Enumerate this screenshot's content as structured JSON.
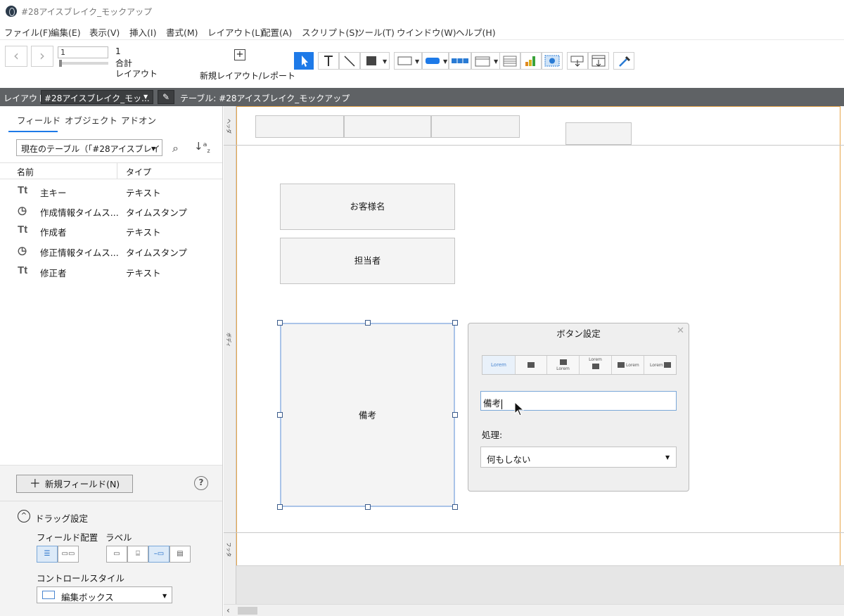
{
  "window": {
    "title": "#28アイスブレイク_モックアップ"
  },
  "menu": [
    "ファイル(F)",
    "編集(E)",
    "表示(V)",
    "挿入(I)",
    "書式(M)",
    "レイアウト(L)",
    "配置(A)",
    "スクリプト(S)",
    "ツール(T)",
    "ウインドウ(W)",
    "ヘルプ(H)"
  ],
  "toolbar": {
    "record_value": "1",
    "record_count": "1",
    "total_label": "合計",
    "mode_label": "レイアウト",
    "new_layout_label": "新規レイアウト/レポート"
  },
  "layout_bar": {
    "layout_label": "レイアウト:",
    "layout_value": "#28アイスブレイク_モッ...",
    "table_label": "テーブル: #28アイスブレイク_モックアップ"
  },
  "sidebar": {
    "tabs": [
      "フィールド",
      "オブジェクト",
      "アドオン"
    ],
    "table_select": "現在のテーブル（「#28アイスブレイ",
    "columns": {
      "name": "名前",
      "type": "タイプ"
    },
    "fields": [
      {
        "icon": "text-icon",
        "glyph": "Tt",
        "name": "主キー",
        "type": "テキスト"
      },
      {
        "icon": "timestamp-icon",
        "glyph": "◷",
        "name": "作成情報タイムス...",
        "type": "タイムスタンプ"
      },
      {
        "icon": "text-icon",
        "glyph": "Tt",
        "name": "作成者",
        "type": "テキスト"
      },
      {
        "icon": "timestamp-icon",
        "glyph": "◷",
        "name": "修正情報タイムス...",
        "type": "タイムスタンプ"
      },
      {
        "icon": "text-icon",
        "glyph": "Tt",
        "name": "修正者",
        "type": "テキスト"
      }
    ],
    "new_field_label": "新規フィールド(N)",
    "drag_settings_label": "ドラッグ設定",
    "field_placement_label": "フィールド配置",
    "label_label": "ラベル",
    "control_style_label": "コントロールスタイル",
    "control_style_value": "編集ボックス"
  },
  "canvas": {
    "parts": {
      "header": "ヘッダ",
      "body": "ボディ",
      "footer": "フッタ"
    },
    "objects": [
      {
        "name": "customer-name-field",
        "label": "お客様名"
      },
      {
        "name": "staff-field",
        "label": "担当者"
      },
      {
        "name": "notes-button",
        "label": "備考"
      }
    ]
  },
  "button_dialog": {
    "title": "ボタン設定",
    "style_options": [
      "Lorem",
      "",
      "Lorem",
      "Lorem",
      "Lorem",
      "Lorem"
    ],
    "label_value": "備考",
    "action_label": "処理:",
    "action_value": "何もしない"
  },
  "colors": {
    "accent": "#1e7ae8",
    "layout_bar": "#5f6265",
    "layout_border": "#e8a64a"
  }
}
